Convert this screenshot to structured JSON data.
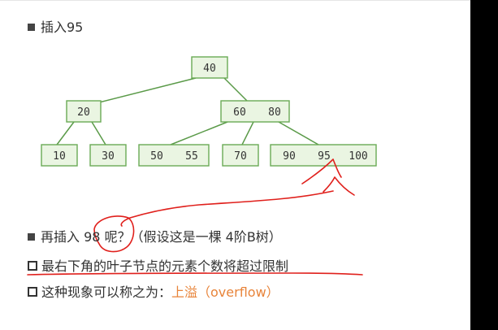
{
  "heading": "插入95",
  "tree": {
    "root": [
      "40"
    ],
    "level1": [
      [
        "20"
      ],
      [
        "60",
        "80"
      ]
    ],
    "leaves": [
      [
        "10"
      ],
      [
        "30"
      ],
      [
        "50",
        "55"
      ],
      [
        "70"
      ],
      [
        "90",
        "95",
        "100"
      ]
    ]
  },
  "lines": {
    "line1_prefix": "再插入",
    "line1_value": "98",
    "line1_suffix": "呢？（假设这是一棵 4阶B树）",
    "line2": "最右下角的叶子节点的元素个数将超过限制",
    "line3_prefix": "这种现象可以称之为：",
    "line3_highlight": "上溢（overflow）"
  },
  "colors": {
    "node_fill": "#eaf5e2",
    "node_stroke": "#6aaa55",
    "annotation": "#e0201c",
    "highlight": "#e8843a"
  }
}
